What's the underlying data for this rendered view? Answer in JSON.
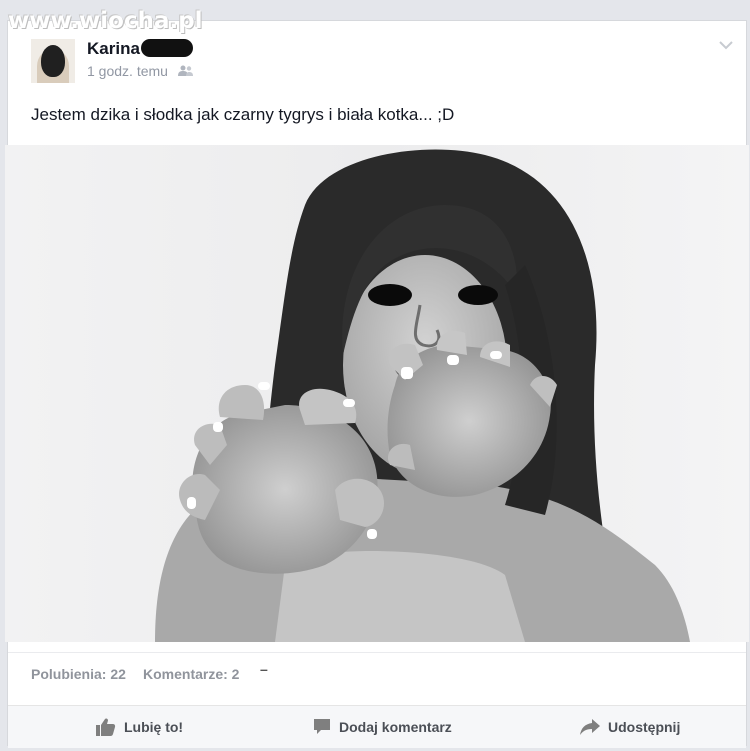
{
  "watermark": "www.wiocha.pl",
  "post": {
    "author": "Karina",
    "time": "1 godz. temu",
    "text": "Jestem dzika i słodka jak czarny tygrys i biała kotka... ;D",
    "photo_alt": "black-and-white photo of a woman making a tiger claw pose"
  },
  "stats": {
    "likes": "Polubienia: 22",
    "comments": "Komentarze: 2",
    "extra": "–"
  },
  "actions": {
    "like": "Lubię to!",
    "comment": "Dodaj komentarz",
    "share": "Udostępnij"
  },
  "icons": {
    "audience": "friends-icon",
    "menu": "chevron-down-icon",
    "like": "thumbs-up-icon",
    "comment": "comment-bubble-icon",
    "share": "share-arrow-icon"
  },
  "colors": {
    "background": "#e4e6eb",
    "card": "#ffffff",
    "text": "#141823",
    "muted": "#90949c"
  }
}
